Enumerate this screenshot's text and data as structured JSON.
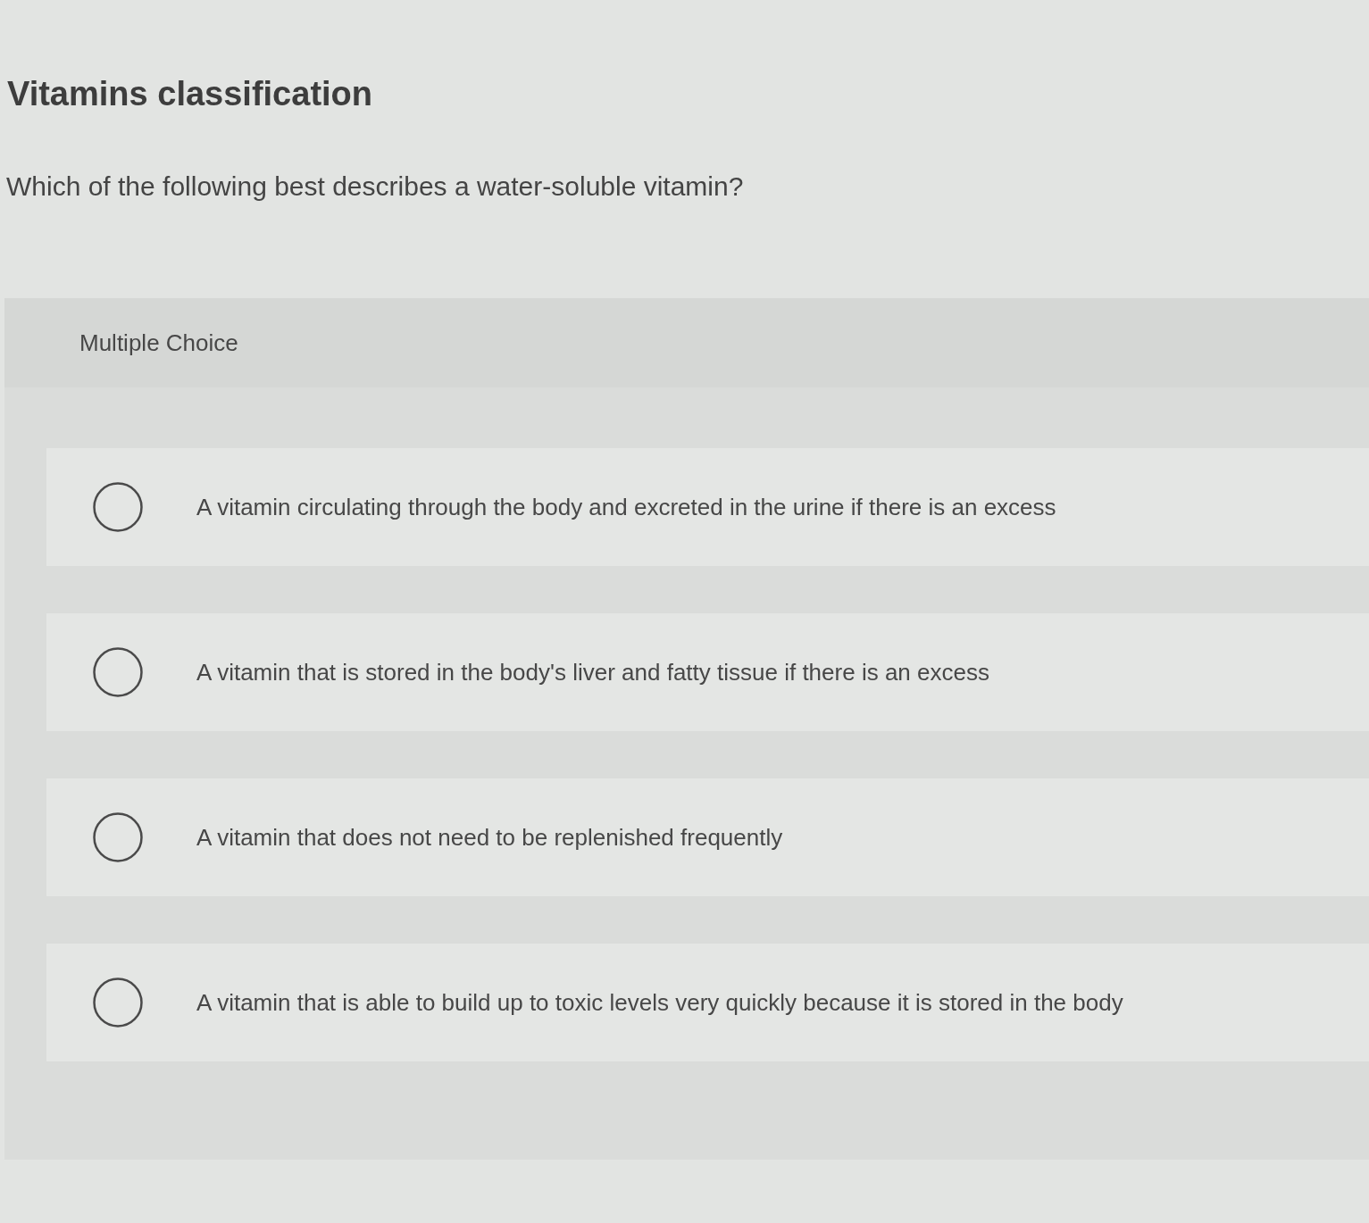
{
  "title": "Vitamins classification",
  "question": "Which of the following best describes a water-soluble vitamin?",
  "answer_panel": {
    "label": "Multiple Choice",
    "options": [
      {
        "text": "A vitamin circulating through the body and excreted in the urine if there is an excess",
        "selected": false
      },
      {
        "text": "A vitamin that is stored in the body's liver and fatty tissue if there is an excess",
        "selected": false
      },
      {
        "text": "A vitamin that does not need to be replenished frequently",
        "selected": false
      },
      {
        "text": "A vitamin that is able to build up to toxic levels very quickly because it is stored in the body",
        "selected": false
      }
    ]
  }
}
